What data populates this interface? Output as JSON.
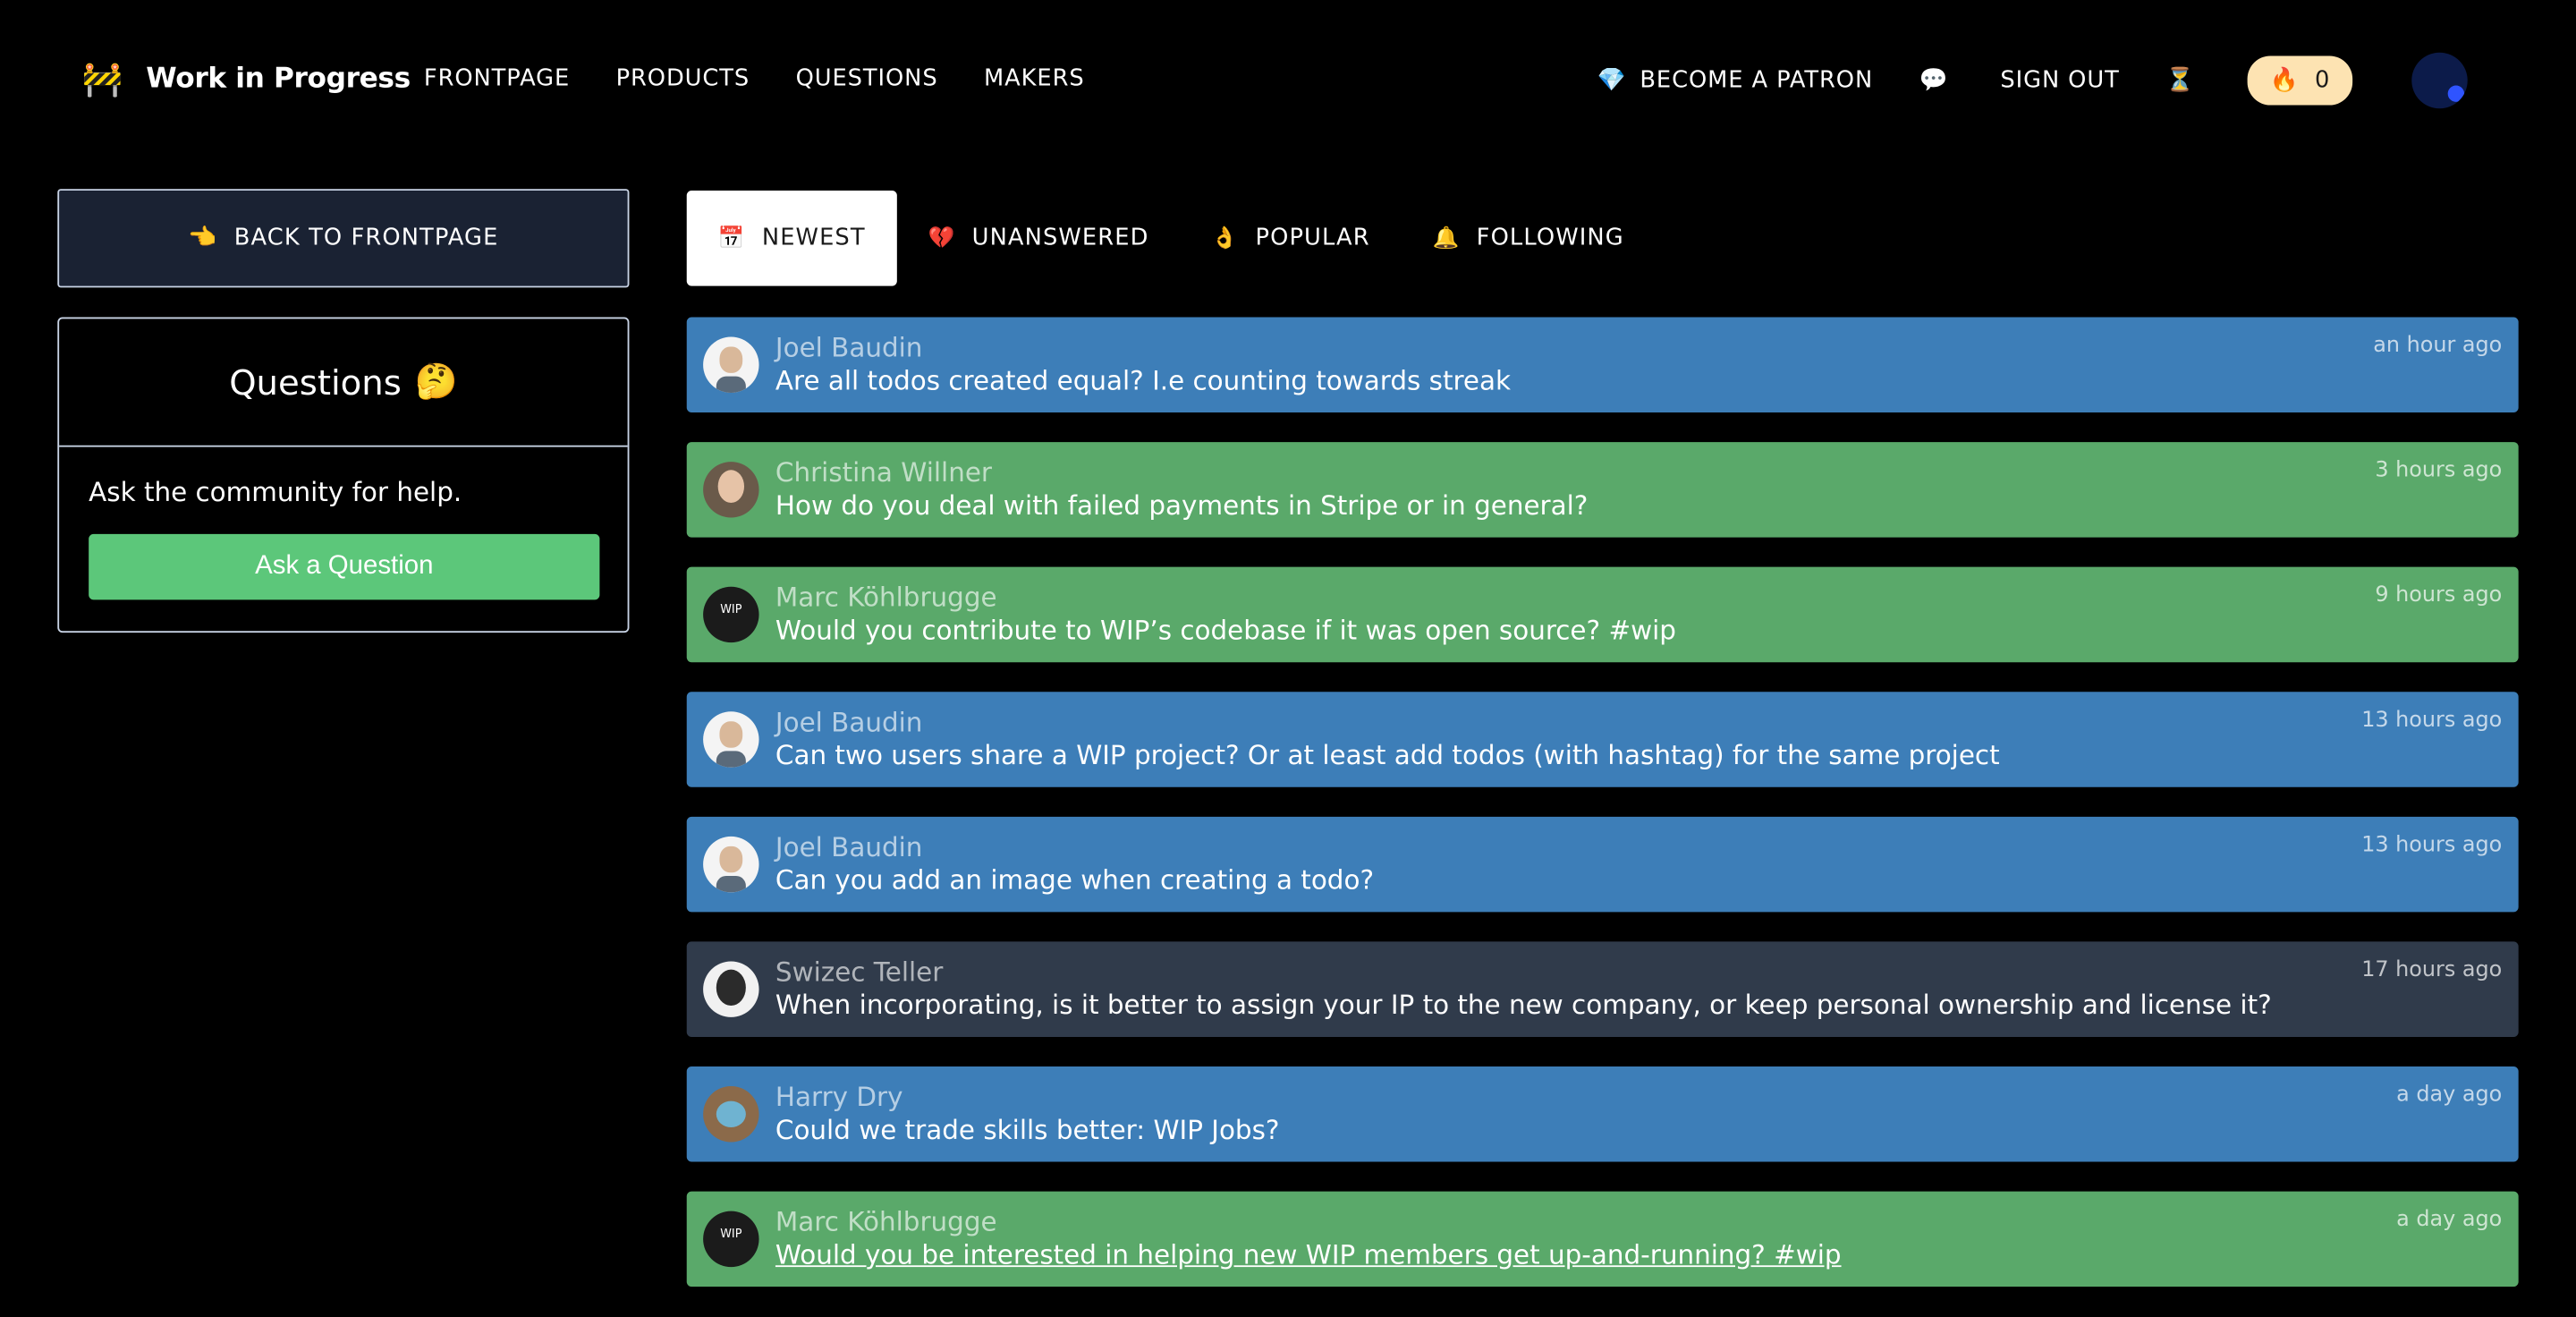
{
  "header": {
    "brand_icon": "🚧",
    "brand_name": "Work in Progress",
    "nav": [
      "FRONTPAGE",
      "PRODUCTS",
      "QUESTIONS",
      "MAKERS"
    ],
    "patron_icon": "💎",
    "patron_label": "BECOME A PATRON",
    "chat_icon": "💬",
    "signout_label": "SIGN OUT",
    "hourglass_icon": "⏳",
    "streak_icon": "🔥",
    "streak_count": "0"
  },
  "sidebar": {
    "back_icon": "👈",
    "back_label": "BACK TO FRONTPAGE",
    "card_title": "Questions",
    "card_emoji": "🤔",
    "card_desc": "Ask the community for help.",
    "ask_label": "Ask a Question"
  },
  "tabs": [
    {
      "icon": "📅",
      "label": "NEWEST",
      "active": true
    },
    {
      "icon": "💔",
      "label": "UNANSWERED",
      "active": false
    },
    {
      "icon": "👌",
      "label": "POPULAR",
      "active": false
    },
    {
      "icon": "🔔",
      "label": "FOLLOWING",
      "active": false
    }
  ],
  "questions": [
    {
      "author": "Joel Baudin",
      "title": "Are all todos created equal? I.e counting towards streak",
      "time": "an hour ago",
      "color": "blue",
      "avatar": "joel"
    },
    {
      "author": "Christina Willner",
      "title": "How do you deal with failed payments in Stripe or in general?",
      "time": "3 hours ago",
      "color": "green",
      "avatar": "christina"
    },
    {
      "author": "Marc Köhlbrugge",
      "title": "Would you contribute to WIP’s codebase if it was open source? #wip",
      "time": "9 hours ago",
      "color": "green",
      "avatar": "marc"
    },
    {
      "author": "Joel Baudin",
      "title": "Can two users share a WIP project? Or at least add todos (with hashtag) for the same project",
      "time": "13 hours ago",
      "color": "blue",
      "avatar": "joel"
    },
    {
      "author": "Joel Baudin",
      "title": "Can you add an image when creating a todo?",
      "time": "13 hours ago",
      "color": "blue",
      "avatar": "joel"
    },
    {
      "author": "Swizec Teller",
      "title": "When incorporating, is it better to assign your IP to the new company, or keep personal ownership and license it?",
      "time": "17 hours ago",
      "color": "slate",
      "avatar": "swizec"
    },
    {
      "author": "Harry Dry",
      "title": "Could we trade skills better: WIP Jobs?",
      "time": "a day ago",
      "color": "blue",
      "avatar": "harry"
    },
    {
      "author": "Marc Köhlbrugge",
      "title": "Would you be interested in helping new WIP members get up-and-running? #wip",
      "time": "a day ago",
      "color": "green",
      "avatar": "marc",
      "underline": true
    }
  ]
}
